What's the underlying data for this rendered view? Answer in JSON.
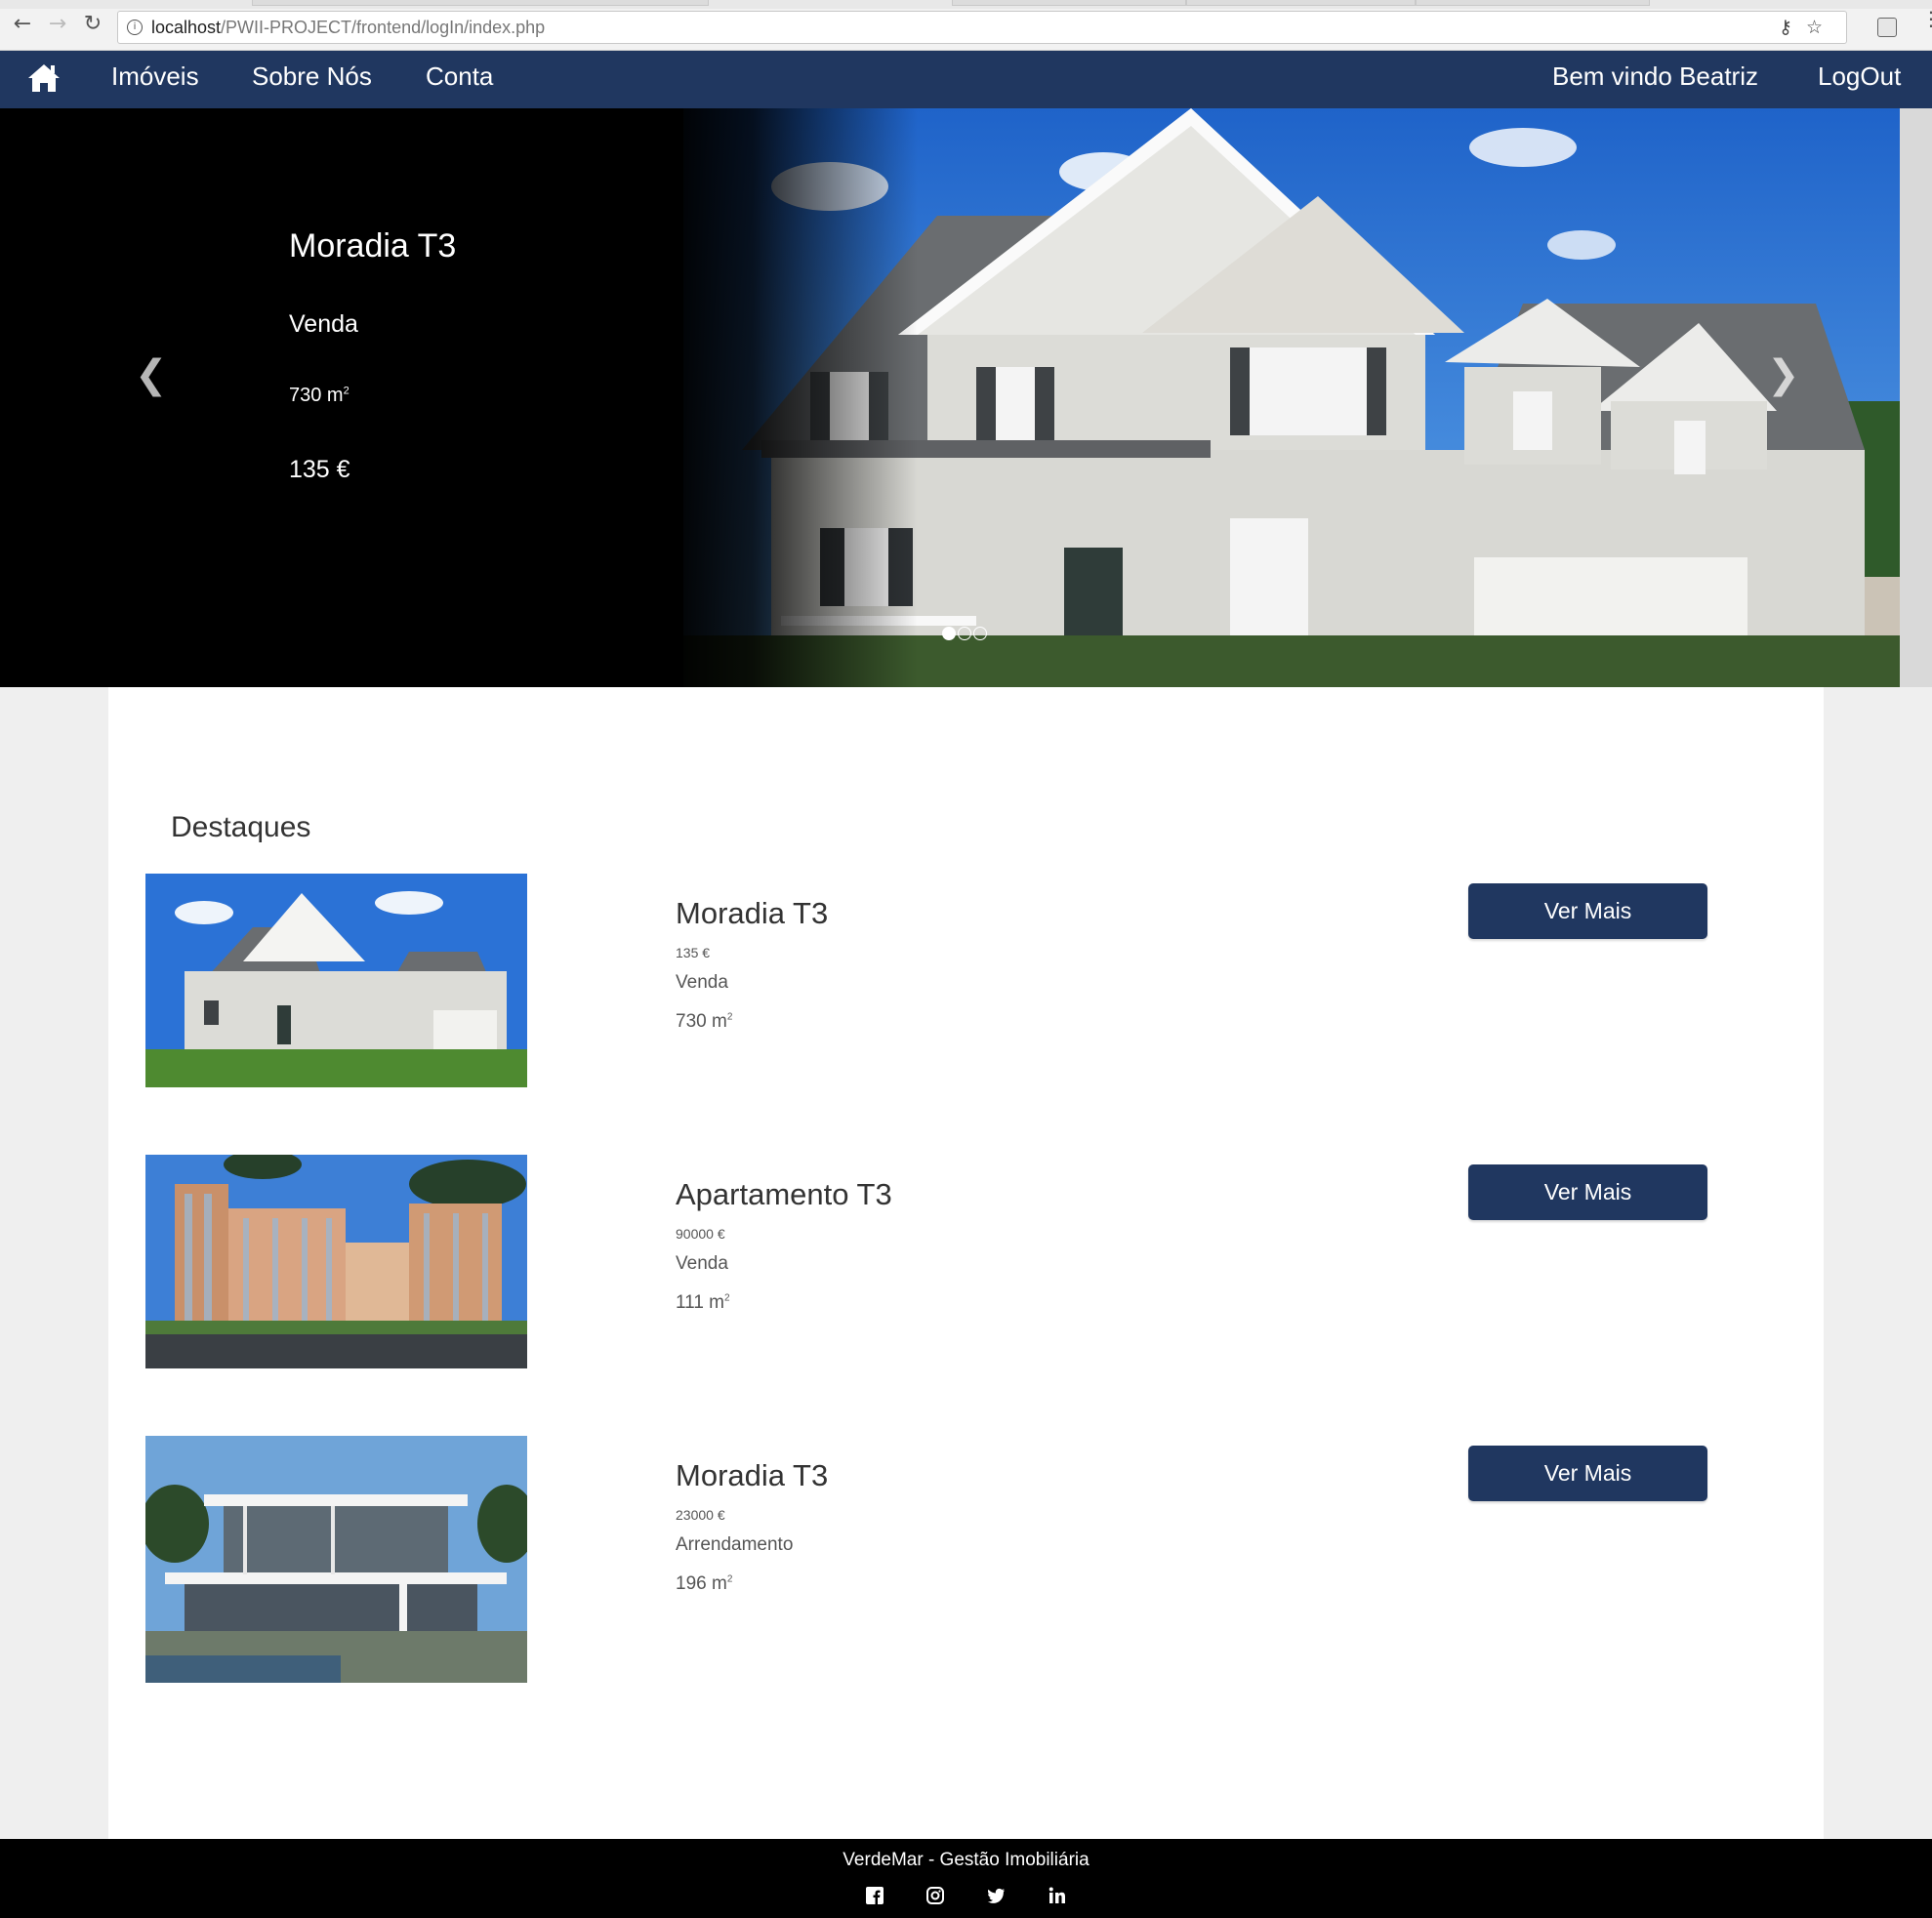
{
  "browser": {
    "url_host": "localhost",
    "url_path": "/PWII-PROJECT/frontend/logIn/index.php",
    "icons": [
      "back-icon",
      "forward-icon",
      "reload-icon",
      "info-icon",
      "key-icon",
      "star-icon",
      "extension-icon",
      "menu-icon"
    ]
  },
  "nav": {
    "links": [
      "Imóveis",
      "Sobre Nós",
      "Conta"
    ],
    "welcome": "Bem vindo Beatriz",
    "logout": "LogOut",
    "brand_color": "#203760"
  },
  "hero": {
    "title": "Moradia T3",
    "type": "Venda",
    "area": "730 m",
    "area_sup": "2",
    "price": "135 €",
    "slides": 3,
    "active_slide": 1
  },
  "featured": {
    "title": "Destaques",
    "button_label": "Ver Mais",
    "items": [
      {
        "title": "Moradia T3",
        "price": "135 €",
        "type": "Venda",
        "area": "730 m",
        "area_sup": "2"
      },
      {
        "title": "Apartamento T3",
        "price": "90000 €",
        "type": "Venda",
        "area": "111 m",
        "area_sup": "2"
      },
      {
        "title": "Moradia T3",
        "price": "23000 €",
        "type": "Arrendamento",
        "area": "196 m",
        "area_sup": "2"
      }
    ]
  },
  "footer": {
    "text": "VerdeMar - Gestão Imobiliária",
    "social": [
      "facebook-icon",
      "instagram-icon",
      "twitter-icon",
      "linkedin-icon"
    ]
  }
}
